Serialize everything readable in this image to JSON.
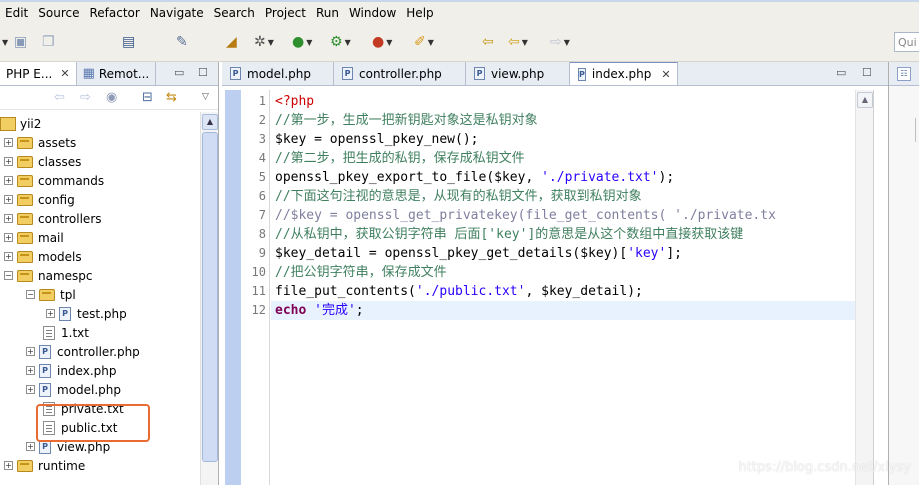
{
  "menu": [
    "Edit",
    "Source",
    "Refactor",
    "Navigate",
    "Search",
    "Project",
    "Run",
    "Window",
    "Help"
  ],
  "toolbar": {
    "quick_access_placeholder": "Qui"
  },
  "left_panel": {
    "tabs": [
      {
        "label": "PHP E...",
        "close": "✕",
        "icon": "php-explorer-icon"
      },
      {
        "label": "Remot...",
        "icon": "remote-systems-icon"
      }
    ],
    "tree": [
      {
        "label": "yii2",
        "type": "project",
        "expanded": true
      },
      {
        "label": "assets",
        "type": "folder"
      },
      {
        "label": "classes",
        "type": "folder"
      },
      {
        "label": "commands",
        "type": "folder"
      },
      {
        "label": "config",
        "type": "folder"
      },
      {
        "label": "controllers",
        "type": "folder"
      },
      {
        "label": "mail",
        "type": "folder"
      },
      {
        "label": "models",
        "type": "folder"
      },
      {
        "label": "namespc",
        "type": "folder",
        "expanded": true
      },
      {
        "label": "tpl",
        "type": "folder",
        "expanded": true
      },
      {
        "label": "test.php",
        "type": "php"
      },
      {
        "label": "1.txt",
        "type": "txt"
      },
      {
        "label": "controller.php",
        "type": "php"
      },
      {
        "label": "index.php",
        "type": "php"
      },
      {
        "label": "model.php",
        "type": "php"
      },
      {
        "label": "private.txt",
        "type": "txt"
      },
      {
        "label": "public.txt",
        "type": "txt"
      },
      {
        "label": "view.php",
        "type": "php"
      },
      {
        "label": "runtime",
        "type": "folder"
      }
    ]
  },
  "editor": {
    "tabs": [
      {
        "label": "model.php",
        "active": false
      },
      {
        "label": "controller.php",
        "active": false
      },
      {
        "label": "view.php",
        "active": false
      },
      {
        "label": "index.php",
        "active": true,
        "close": "✕"
      }
    ],
    "line_numbers": [
      "1",
      "2",
      "3",
      "4",
      "5",
      "6",
      "7",
      "8",
      "9",
      "10",
      "11",
      "12"
    ],
    "current_line": 12,
    "lines": [
      [
        {
          "t": "<?php",
          "c": "tag"
        }
      ],
      [
        {
          "t": "//第一步，生成一把新钥匙对象这是私钥对象",
          "c": "com"
        }
      ],
      [
        {
          "t": "$key = openssl_pkey_new();",
          "c": "def"
        }
      ],
      [
        {
          "t": "//第二步，把生成的私钥，保存成私钥文件",
          "c": "com"
        }
      ],
      [
        {
          "t": "openssl_pkey_export_to_file($key, ",
          "c": "def"
        },
        {
          "t": "'./private.txt'",
          "c": "str"
        },
        {
          "t": ");",
          "c": "def"
        }
      ],
      [
        {
          "t": "//下面这句注视的意思是，从现有的私钥文件，获取到私钥对象",
          "c": "com"
        }
      ],
      [
        {
          "t": "//$key = openssl_get_privatekey(file_get_contents( './private.tx",
          "c": "com2"
        }
      ],
      [
        {
          "t": "//从私钥中，获取公钥字符串 后面['key']的意思是从这个数组中直接获取该键",
          "c": "com"
        }
      ],
      [
        {
          "t": "$key_detail = openssl_pkey_get_details($key)[",
          "c": "def"
        },
        {
          "t": "'key'",
          "c": "str"
        },
        {
          "t": "];",
          "c": "def"
        }
      ],
      [
        {
          "t": "//把公钥字符串，保存成文件",
          "c": "com"
        }
      ],
      [
        {
          "t": "file_put_contents(",
          "c": "def"
        },
        {
          "t": "'./public.txt'",
          "c": "str"
        },
        {
          "t": ", $key_detail);",
          "c": "def"
        }
      ],
      [
        {
          "t": "echo",
          "c": "kw"
        },
        {
          "t": " ",
          "c": "def"
        },
        {
          "t": "'完成'",
          "c": "str"
        },
        {
          "t": ";",
          "c": "def"
        }
      ]
    ]
  },
  "watermark": "https://blog.csdn.net/xlysy",
  "colors": {
    "highlight_box": "#ea6b32",
    "current_line": "#e8f2fe",
    "comment": "#3f7f5f",
    "string": "#2a00ff",
    "keyword": "#7f0055",
    "php_tag": "#d00000"
  }
}
